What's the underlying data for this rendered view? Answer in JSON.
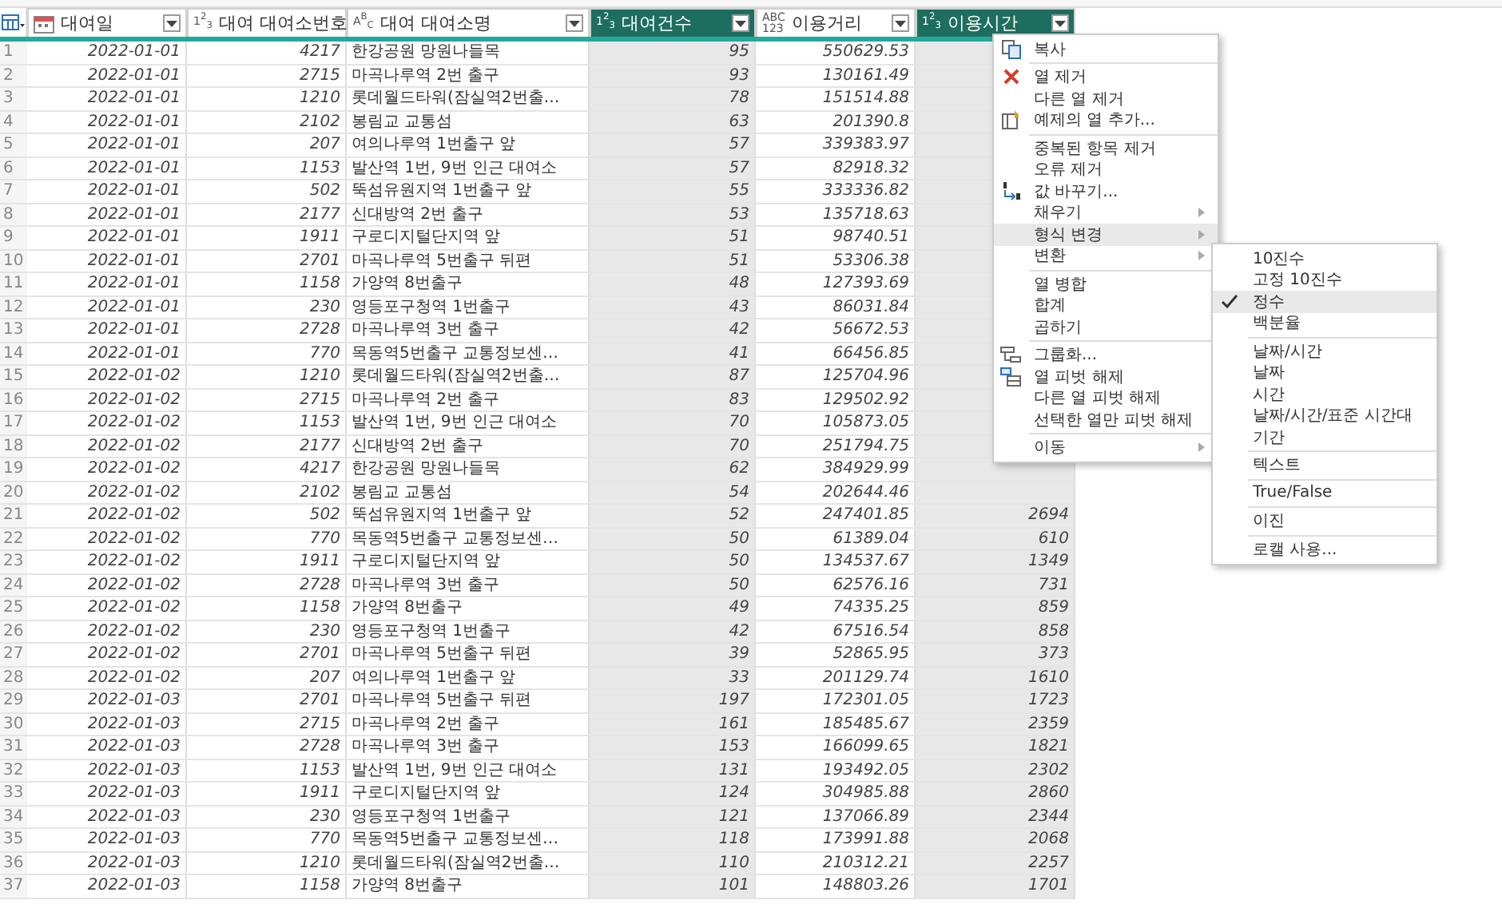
{
  "table": {
    "columns": [
      {
        "label": "대여일",
        "kind": "date",
        "selected": false
      },
      {
        "label": "대여 대여소번호",
        "kind": "glyph",
        "glyph": [
          "1$^{2}$$_{3}$"
        ],
        "selected": false
      },
      {
        "label": "대여 대여소명",
        "kind": "glyph",
        "glyph": [
          "A$^{B}$$_{C}$"
        ],
        "selected": false
      },
      {
        "label": "대여건수",
        "kind": "glyph",
        "glyph": [
          "1$^{2}$$_{3}$"
        ],
        "selected": true
      },
      {
        "label": "이용거리",
        "kind": "glyph",
        "glyph": [
          "ABC",
          "123"
        ],
        "selected": false
      },
      {
        "label": "이용시간",
        "kind": "glyph",
        "glyph": [
          "1$^{2}$$_{3}$"
        ],
        "selected": true
      }
    ],
    "rows": [
      {
        "n": "1",
        "cells": [
          "2022-01-01",
          "4217",
          "한강공원 망원나들목",
          "95",
          "550629.53"
        ]
      },
      {
        "n": "2",
        "cells": [
          "2022-01-01",
          "2715",
          "마곡나루역 2번 출구",
          "93",
          "130161.49"
        ]
      },
      {
        "n": "3",
        "cells": [
          "2022-01-01",
          "1210",
          "롯데월드타워(잠실역2번출…",
          "78",
          "151514.88"
        ]
      },
      {
        "n": "4",
        "cells": [
          "2022-01-01",
          "2102",
          "봉림교 교통섬",
          "63",
          "201390.8"
        ]
      },
      {
        "n": "5",
        "cells": [
          "2022-01-01",
          "207",
          "여의나루역 1번출구 앞",
          "57",
          "339383.97"
        ]
      },
      {
        "n": "6",
        "cells": [
          "2022-01-01",
          "1153",
          "발산역 1번, 9번 인근 대여소",
          "57",
          "82918.32"
        ]
      },
      {
        "n": "7",
        "cells": [
          "2022-01-01",
          "502",
          "뚝섬유원지역 1번출구 앞",
          "55",
          "333336.82"
        ]
      },
      {
        "n": "8",
        "cells": [
          "2022-01-01",
          "2177",
          "신대방역 2번 출구",
          "53",
          "135718.63"
        ]
      },
      {
        "n": "9",
        "cells": [
          "2022-01-01",
          "1911",
          "구로디지털단지역 앞",
          "51",
          "98740.51"
        ]
      },
      {
        "n": "10",
        "cells": [
          "2022-01-01",
          "2701",
          "마곡나루역 5번출구 뒤편",
          "51",
          "53306.38"
        ]
      },
      {
        "n": "11",
        "cells": [
          "2022-01-01",
          "1158",
          "가양역 8번출구",
          "48",
          "127393.69"
        ]
      },
      {
        "n": "12",
        "cells": [
          "2022-01-01",
          "230",
          "영등포구청역 1번출구",
          "43",
          "86031.84"
        ]
      },
      {
        "n": "13",
        "cells": [
          "2022-01-01",
          "2728",
          "마곡나루역 3번 출구",
          "42",
          "56672.53"
        ]
      },
      {
        "n": "14",
        "cells": [
          "2022-01-01",
          "770",
          "목동역5번출구 교통정보센…",
          "41",
          "66456.85"
        ]
      },
      {
        "n": "15",
        "cells": [
          "2022-01-02",
          "1210",
          "롯데월드타워(잠실역2번출…",
          "87",
          "125704.96"
        ]
      },
      {
        "n": "16",
        "cells": [
          "2022-01-02",
          "2715",
          "마곡나루역 2번 출구",
          "83",
          "129502.92"
        ]
      },
      {
        "n": "17",
        "cells": [
          "2022-01-02",
          "1153",
          "발산역 1번, 9번 인근 대여소",
          "70",
          "105873.05"
        ]
      },
      {
        "n": "18",
        "cells": [
          "2022-01-02",
          "2177",
          "신대방역 2번 출구",
          "70",
          "251794.75"
        ]
      },
      {
        "n": "19",
        "cells": [
          "2022-01-02",
          "4217",
          "한강공원 망원나들목",
          "62",
          "384929.99"
        ]
      },
      {
        "n": "20",
        "cells": [
          "2022-01-02",
          "2102",
          "봉림교 교통섬",
          "54",
          "202644.46"
        ]
      },
      {
        "n": "21",
        "cells": [
          "2022-01-02",
          "502",
          "뚝섬유원지역 1번출구 앞",
          "52",
          "247401.85",
          "2694"
        ]
      },
      {
        "n": "22",
        "cells": [
          "2022-01-02",
          "770",
          "목동역5번출구 교통정보센…",
          "50",
          "61389.04",
          "610"
        ]
      },
      {
        "n": "23",
        "cells": [
          "2022-01-02",
          "1911",
          "구로디지털단지역 앞",
          "50",
          "134537.67",
          "1349"
        ]
      },
      {
        "n": "24",
        "cells": [
          "2022-01-02",
          "2728",
          "마곡나루역 3번 출구",
          "50",
          "62576.16",
          "731"
        ]
      },
      {
        "n": "25",
        "cells": [
          "2022-01-02",
          "1158",
          "가양역 8번출구",
          "49",
          "74335.25",
          "859"
        ]
      },
      {
        "n": "26",
        "cells": [
          "2022-01-02",
          "230",
          "영등포구청역 1번출구",
          "42",
          "67516.54",
          "858"
        ]
      },
      {
        "n": "27",
        "cells": [
          "2022-01-02",
          "2701",
          "마곡나루역 5번출구 뒤편",
          "39",
          "52865.95",
          "373"
        ]
      },
      {
        "n": "28",
        "cells": [
          "2022-01-02",
          "207",
          "여의나루역 1번출구 앞",
          "33",
          "201129.74",
          "1610"
        ]
      },
      {
        "n": "29",
        "cells": [
          "2022-01-03",
          "2701",
          "마곡나루역 5번출구 뒤편",
          "197",
          "172301.05",
          "1723"
        ]
      },
      {
        "n": "30",
        "cells": [
          "2022-01-03",
          "2715",
          "마곡나루역 2번 출구",
          "161",
          "185485.67",
          "2359"
        ]
      },
      {
        "n": "31",
        "cells": [
          "2022-01-03",
          "2728",
          "마곡나루역 3번 출구",
          "153",
          "166099.65",
          "1821"
        ]
      },
      {
        "n": "32",
        "cells": [
          "2022-01-03",
          "1153",
          "발산역 1번, 9번 인근 대여소",
          "131",
          "193492.05",
          "2302"
        ]
      },
      {
        "n": "33",
        "cells": [
          "2022-01-03",
          "1911",
          "구로디지털단지역 앞",
          "124",
          "304985.88",
          "2860"
        ]
      },
      {
        "n": "34",
        "cells": [
          "2022-01-03",
          "230",
          "영등포구청역 1번출구",
          "121",
          "137066.89",
          "2344"
        ]
      },
      {
        "n": "35",
        "cells": [
          "2022-01-03",
          "770",
          "목동역5번출구 교통정보센…",
          "118",
          "173991.88",
          "2068"
        ]
      },
      {
        "n": "36",
        "cells": [
          "2022-01-03",
          "1210",
          "롯데월드타워(잠실역2번출…",
          "110",
          "210312.21",
          "2257"
        ]
      },
      {
        "n": "37",
        "cells": [
          "2022-01-03",
          "1158",
          "가양역 8번출구",
          "101",
          "148803.26",
          "1701"
        ]
      }
    ]
  },
  "context_menu": {
    "sections": [
      [
        {
          "label": "복사",
          "kind": "copy",
          "submenu": false,
          "selected": false
        }
      ],
      [
        {
          "label": "열 제거",
          "kind": "remove",
          "submenu": false,
          "selected": false
        },
        {
          "label": "다른 열 제거",
          "kind": "plain",
          "submenu": false,
          "selected": false
        },
        {
          "label": "예제의 열 추가...",
          "kind": "examples",
          "submenu": false,
          "selected": false
        }
      ],
      [
        {
          "label": "중복된 항목 제거",
          "kind": "plain",
          "submenu": false,
          "selected": false
        },
        {
          "label": "오류 제거",
          "kind": "plain",
          "submenu": false,
          "selected": false
        },
        {
          "label": "값 바꾸기...",
          "kind": "replace",
          "submenu": false,
          "selected": false
        },
        {
          "label": "채우기",
          "kind": "plain",
          "submenu": true,
          "selected": false
        },
        {
          "label": "형식 변경",
          "kind": "plain",
          "submenu": true,
          "selected": true
        },
        {
          "label": "변환",
          "kind": "plain",
          "submenu": true,
          "selected": false
        }
      ],
      [
        {
          "label": "열 병합",
          "kind": "plain",
          "submenu": false,
          "selected": false
        },
        {
          "label": "합계",
          "kind": "plain",
          "submenu": false,
          "selected": false
        },
        {
          "label": "곱하기",
          "kind": "plain",
          "submenu": false,
          "selected": false
        }
      ],
      [
        {
          "label": "그룹화...",
          "kind": "group",
          "submenu": false,
          "selected": false
        },
        {
          "label": "열 피벗 해제",
          "kind": "unpivot",
          "submenu": false,
          "selected": false
        },
        {
          "label": "다른 열 피벗 해제",
          "kind": "plain",
          "submenu": false,
          "selected": false
        },
        {
          "label": "선택한 열만 피벗 해제",
          "kind": "plain",
          "submenu": false,
          "selected": false
        }
      ],
      [
        {
          "label": "이동",
          "kind": "plain",
          "submenu": true,
          "selected": false
        }
      ]
    ]
  },
  "type_submenu": {
    "sections": [
      [
        {
          "label": "10진수",
          "checked": false,
          "selected": false
        },
        {
          "label": "고정 10진수",
          "checked": false,
          "selected": false
        },
        {
          "label": "정수",
          "checked": true,
          "selected": true
        },
        {
          "label": "백분율",
          "checked": false,
          "selected": false
        }
      ],
      [
        {
          "label": "날짜/시간",
          "checked": false,
          "selected": false
        },
        {
          "label": "날짜",
          "checked": false,
          "selected": false
        },
        {
          "label": "시간",
          "checked": false,
          "selected": false
        },
        {
          "label": "날짜/시간/표준 시간대",
          "checked": false,
          "selected": false
        },
        {
          "label": "기간",
          "checked": false,
          "selected": false
        }
      ],
      [
        {
          "label": "텍스트",
          "checked": false,
          "selected": false
        }
      ],
      [
        {
          "label": "True/False",
          "checked": false,
          "selected": false
        }
      ],
      [
        {
          "label": "이진",
          "checked": false,
          "selected": false
        }
      ],
      [
        {
          "label": "로캘 사용...",
          "checked": false,
          "selected": false
        }
      ]
    ]
  }
}
